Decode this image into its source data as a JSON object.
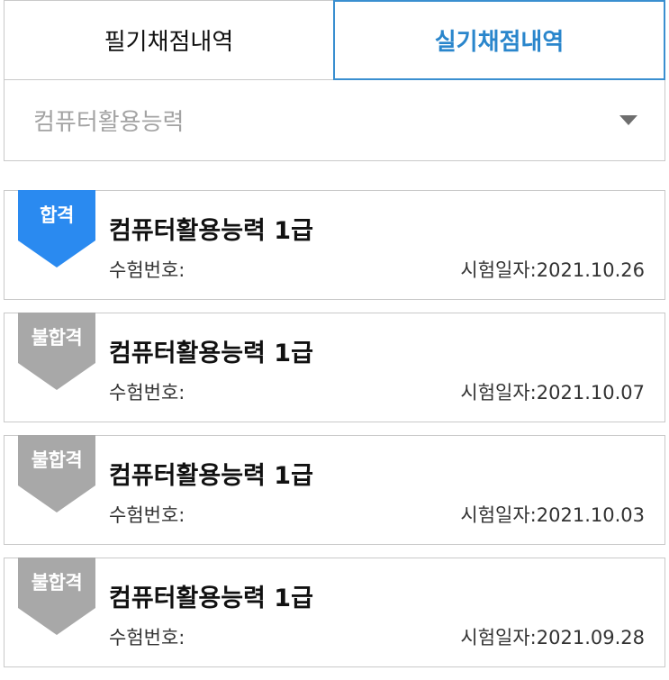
{
  "tabs": {
    "written": "필기채점내역",
    "practical": "실기채점내역"
  },
  "dropdown": {
    "selected": "컴퓨터활용능력"
  },
  "colors": {
    "pass": "#2a8af0",
    "fail": "#a8a8a8",
    "active_tab": "#2a86cc"
  },
  "results": [
    {
      "status": "합격",
      "title": "컴퓨터활용능력 1급",
      "exam_no_label": "수험번호:",
      "date_text": "시험일자:2021.10.26"
    },
    {
      "status": "불합격",
      "title": "컴퓨터활용능력 1급",
      "exam_no_label": "수험번호:",
      "date_text": "시험일자:2021.10.07"
    },
    {
      "status": "불합격",
      "title": "컴퓨터활용능력 1급",
      "exam_no_label": "수험번호:",
      "date_text": "시험일자:2021.10.03"
    },
    {
      "status": "불합격",
      "title": "컴퓨터활용능력 1급",
      "exam_no_label": "수험번호:",
      "date_text": "시험일자:2021.09.28"
    }
  ]
}
